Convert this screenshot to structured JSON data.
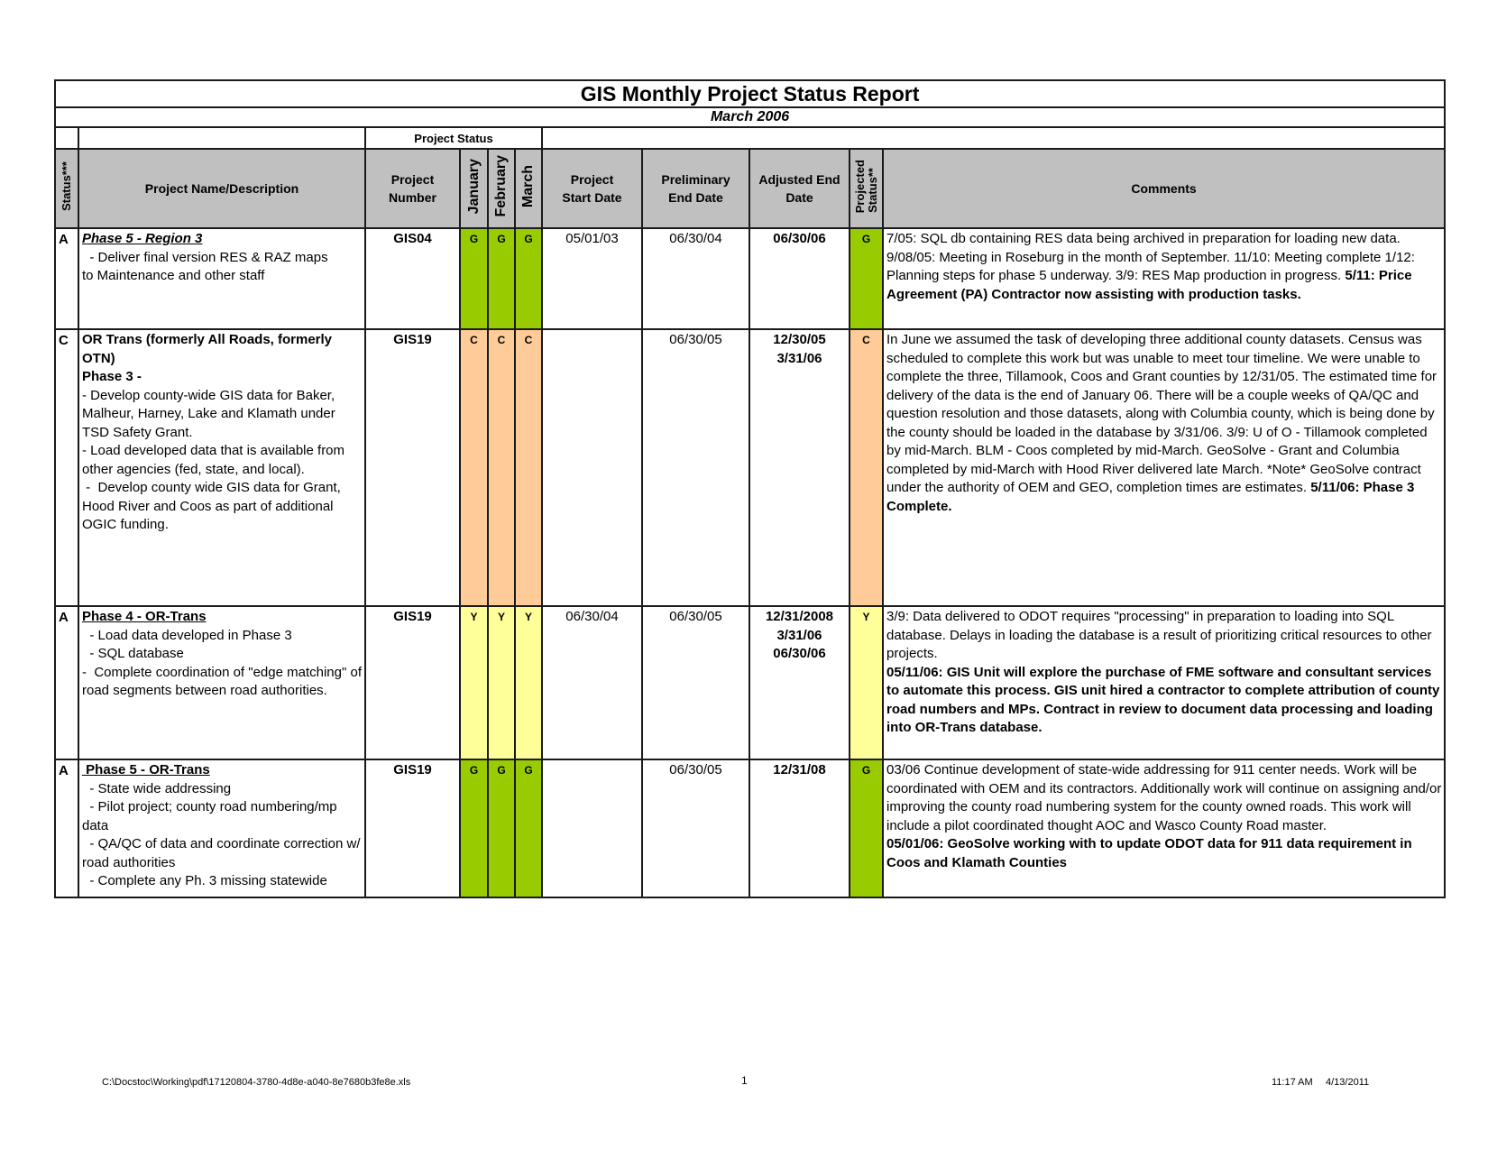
{
  "report": {
    "title": "GIS Monthly Project Status Report",
    "subtitle": "March 2006"
  },
  "header": {
    "group_label": "Project Status",
    "status": "Status***",
    "name": "Project Name/Description",
    "number_line1": "Project",
    "number_line2": "Number",
    "months": [
      "January",
      "February",
      "March"
    ],
    "start_line1": "Project",
    "start_line2": "Start Date",
    "prelim_line1": "Preliminary",
    "prelim_line2": "End Date",
    "adjusted_line1": "Adjusted End",
    "adjusted_line2": "Date",
    "projected_line1": "Projected",
    "projected_line2": "Status**",
    "comments": "Comments"
  },
  "colors": {
    "G": "#99cc00",
    "C": "#ffcc99",
    "Y": "#ffff99",
    "header_bg": "#c0c0c0"
  },
  "rows": [
    {
      "status": "A",
      "title": "Phase 5 - Region 3",
      "description": [
        "  - Deliver final version RES & RAZ maps",
        "to Maintenance and other staff"
      ],
      "number": "GIS04",
      "months": [
        "G",
        "G",
        "G"
      ],
      "start": "05/01/03",
      "prelim_end": "06/30/04",
      "adjusted_end": [
        "06/30/06"
      ],
      "projected": "G",
      "comment_plain": "7/05: SQL db containing RES data being archived in preparation for loading new data.  9/08/05:  Meeting in Roseburg in the month of September.  11/10: Meeting complete 1/12: Planning steps for phase 5 underway.  3/9: RES Map production in progress. ",
      "comment_bold": "5/11: Price Agreement (PA) Contractor now assisting with production tasks."
    },
    {
      "status": "C",
      "title_line1": "OR Trans (formerly All Roads, formerly OTN)",
      "title_line2": "Phase 3 -",
      "description": [
        "- Develop county-wide GIS data for Baker, Malheur, Harney, Lake and Klamath under TSD Safety Grant.",
        "-  Load developed data that is available from other agencies (fed, state, and local).",
        " -  Develop county wide GIS data for Grant, Hood River and Coos as part of additional OGIC funding."
      ],
      "number": "GIS19",
      "months": [
        "C",
        "C",
        "C"
      ],
      "start": "",
      "prelim_end": "06/30/05",
      "adjusted_end": [
        "12/30/05",
        "3/31/06"
      ],
      "projected": "C",
      "comment_plain": "In June we assumed the task of developing three additional  county datasets. Census was scheduled to complete this work but was unable to meet tour timeline. We were unable to complete the three, Tillamook, Coos and Grant counties by 12/31/05. The estimated time for delivery of the data is the end of January 06. There will be a couple weeks of QA/QC and question resolution and those datasets, along with Columbia county, which is being done by the county should be loaded in the database by 3/31/06.  3/9: U of O - Tillamook completed by mid-March. BLM - Coos completed by mid-March. GeoSolve - Grant and Columbia completed by mid-March with Hood River delivered late March. *Note* GeoSolve contract under the authority of OEM and GEO, completion times are estimates. ",
      "comment_bold": "5/11/06: Phase 3 Complete."
    },
    {
      "status": "A",
      "title": "Phase 4 - OR-Trans",
      "description": [
        "  - Load data developed in Phase 3",
        "  - SQL database",
        "-  Complete coordination of \"edge matching\" of road segments between road authorities."
      ],
      "number": "GIS19",
      "months": [
        "Y",
        "Y",
        "Y"
      ],
      "start": "06/30/04",
      "prelim_end": "06/30/05",
      "adjusted_end": [
        "12/31/2008",
        "3/31/06",
        "06/30/06"
      ],
      "projected": "Y",
      "comment_plain": "3/9: Data delivered to ODOT requires \"processing\" in preparation to loading into SQL database. Delays in loading the database is a result of prioritizing critical resources to other projects.",
      "comment_bold": "05/11/06: GIS Unit will explore the purchase of FME software and consultant services to automate this process.  GIS unit hired a contractor to complete attribution of county road numbers and MPs.  Contract in review to document data processing and loading into OR-Trans database."
    },
    {
      "status": "A",
      "title": " Phase 5 - OR-Trans",
      "description": [
        "  - State wide addressing",
        "  - Pilot project; county road numbering/mp data",
        "  - QA/QC of data and coordinate correction w/ road authorities",
        "  - Complete any Ph. 3 missing statewide"
      ],
      "number": "GIS19",
      "months": [
        "G",
        "G",
        "G"
      ],
      "start": "",
      "prelim_end": "06/30/05",
      "adjusted_end": [
        "12/31/08"
      ],
      "projected": "G",
      "comment_plain": "03/06 Continue development of state-wide addressing for 911 center needs. Work will be coordinated with OEM and its contractors.  Additionally work will continue on assigning and/or improving the county road numbering system for the county owned roads.  This work will include a pilot coordinated thought AOC and Wasco County Road master.",
      "comment_bold": "05/01/06: GeoSolve working with to update ODOT data for 911 data requirement in Coos and Klamath Counties"
    }
  ],
  "footer": {
    "path": "C:\\Docstoc\\Working\\pdf\\17120804-3780-4d8e-a040-8e7680b3fe8e.xls",
    "page": "1",
    "time": "11:17 AM",
    "date": "4/13/2011"
  }
}
